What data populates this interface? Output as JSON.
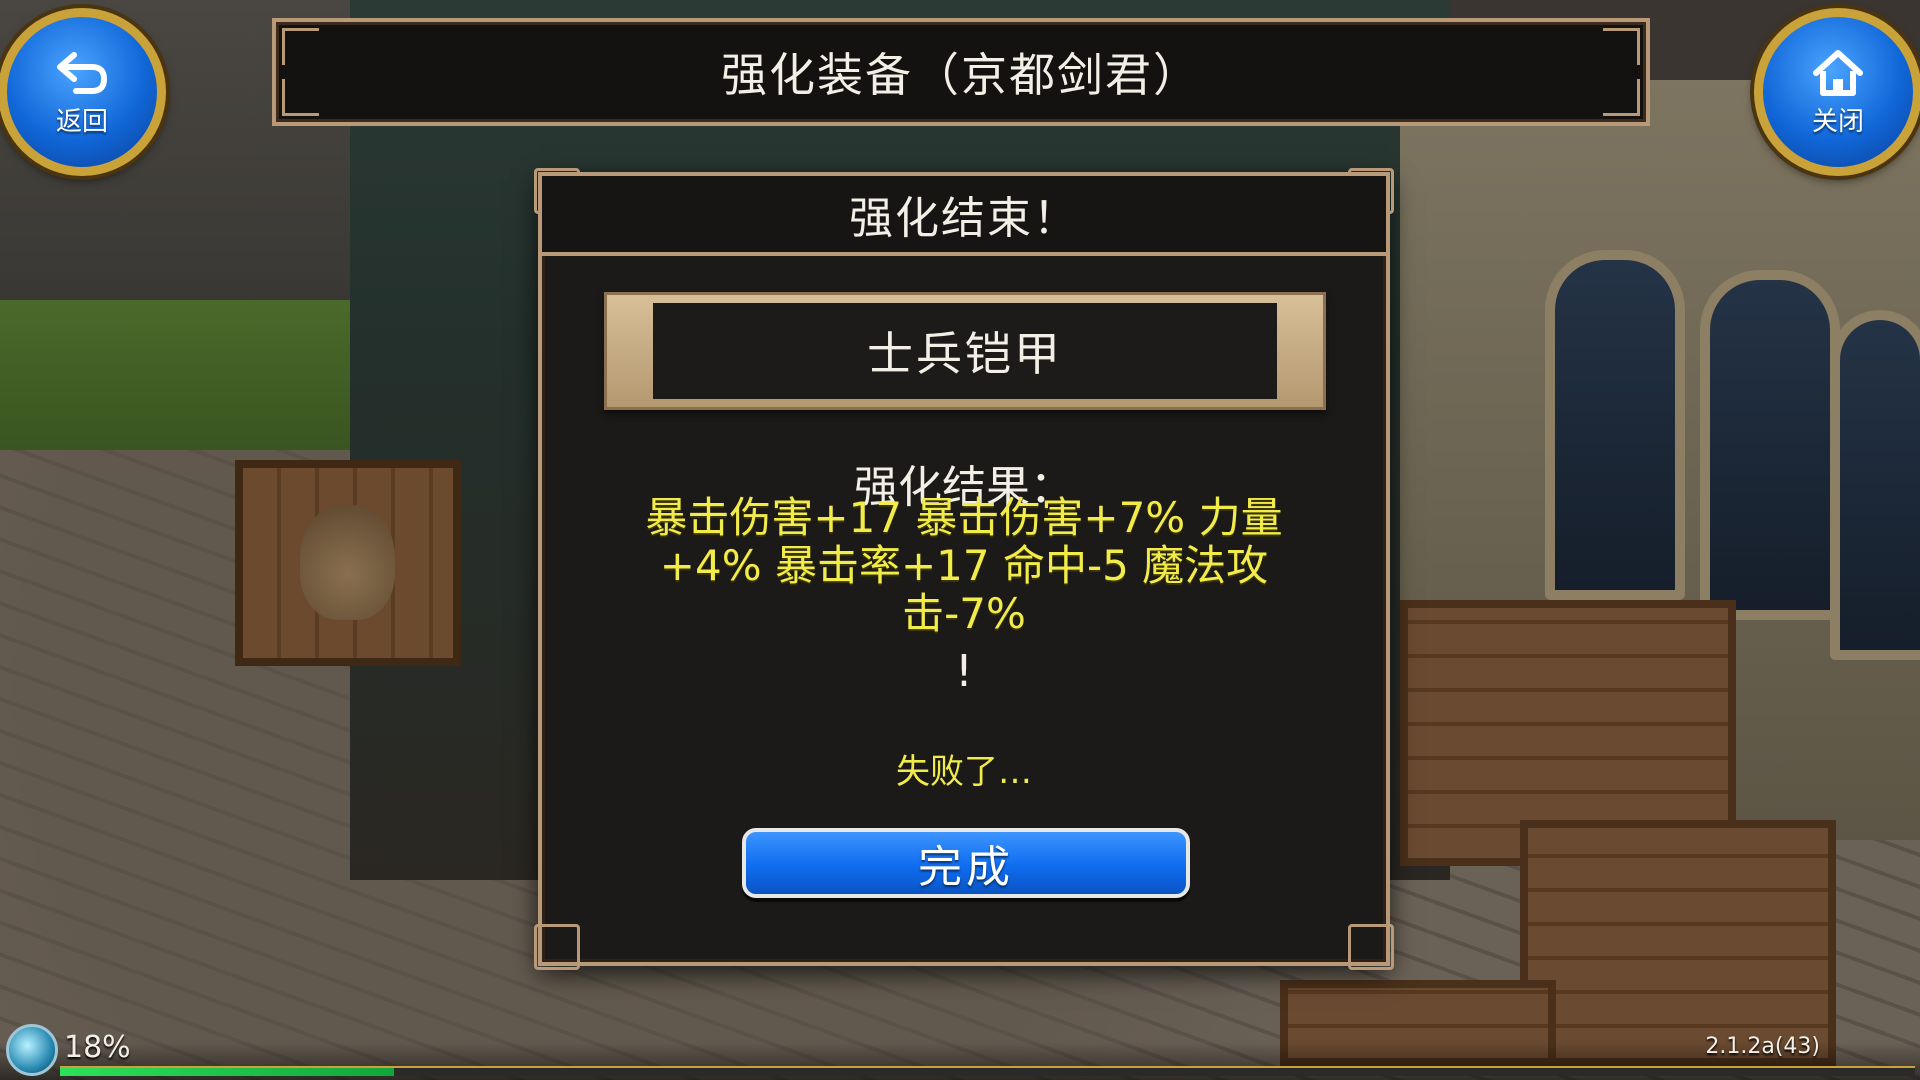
{
  "header": {
    "title": "强化装备（京都剑君）",
    "back_label": "返回",
    "close_label": "关闭"
  },
  "dialog": {
    "title": "强化结束！",
    "item_name": "士兵铠甲",
    "result_label": "强化结果：",
    "result_detail": "暴击伤害+17 暴击伤害+7% 力量+4% 暴击率+17 命中-5 魔法攻击-7%",
    "result_exclaim": "!",
    "fail_text": "失败了…",
    "done_label": "完成"
  },
  "status": {
    "exp_percent": "18%",
    "exp_fraction": 0.18,
    "version": "2.1.2a(43)"
  },
  "colors": {
    "accent_blue": "#1167d8",
    "gold_frame": "#b89a78",
    "result_yellow": "#f2ec4a",
    "exp_green": "#2ee05a"
  },
  "icons": {
    "back": "back-arrow-icon",
    "close": "home-icon",
    "exp": "exp-orb-icon"
  }
}
